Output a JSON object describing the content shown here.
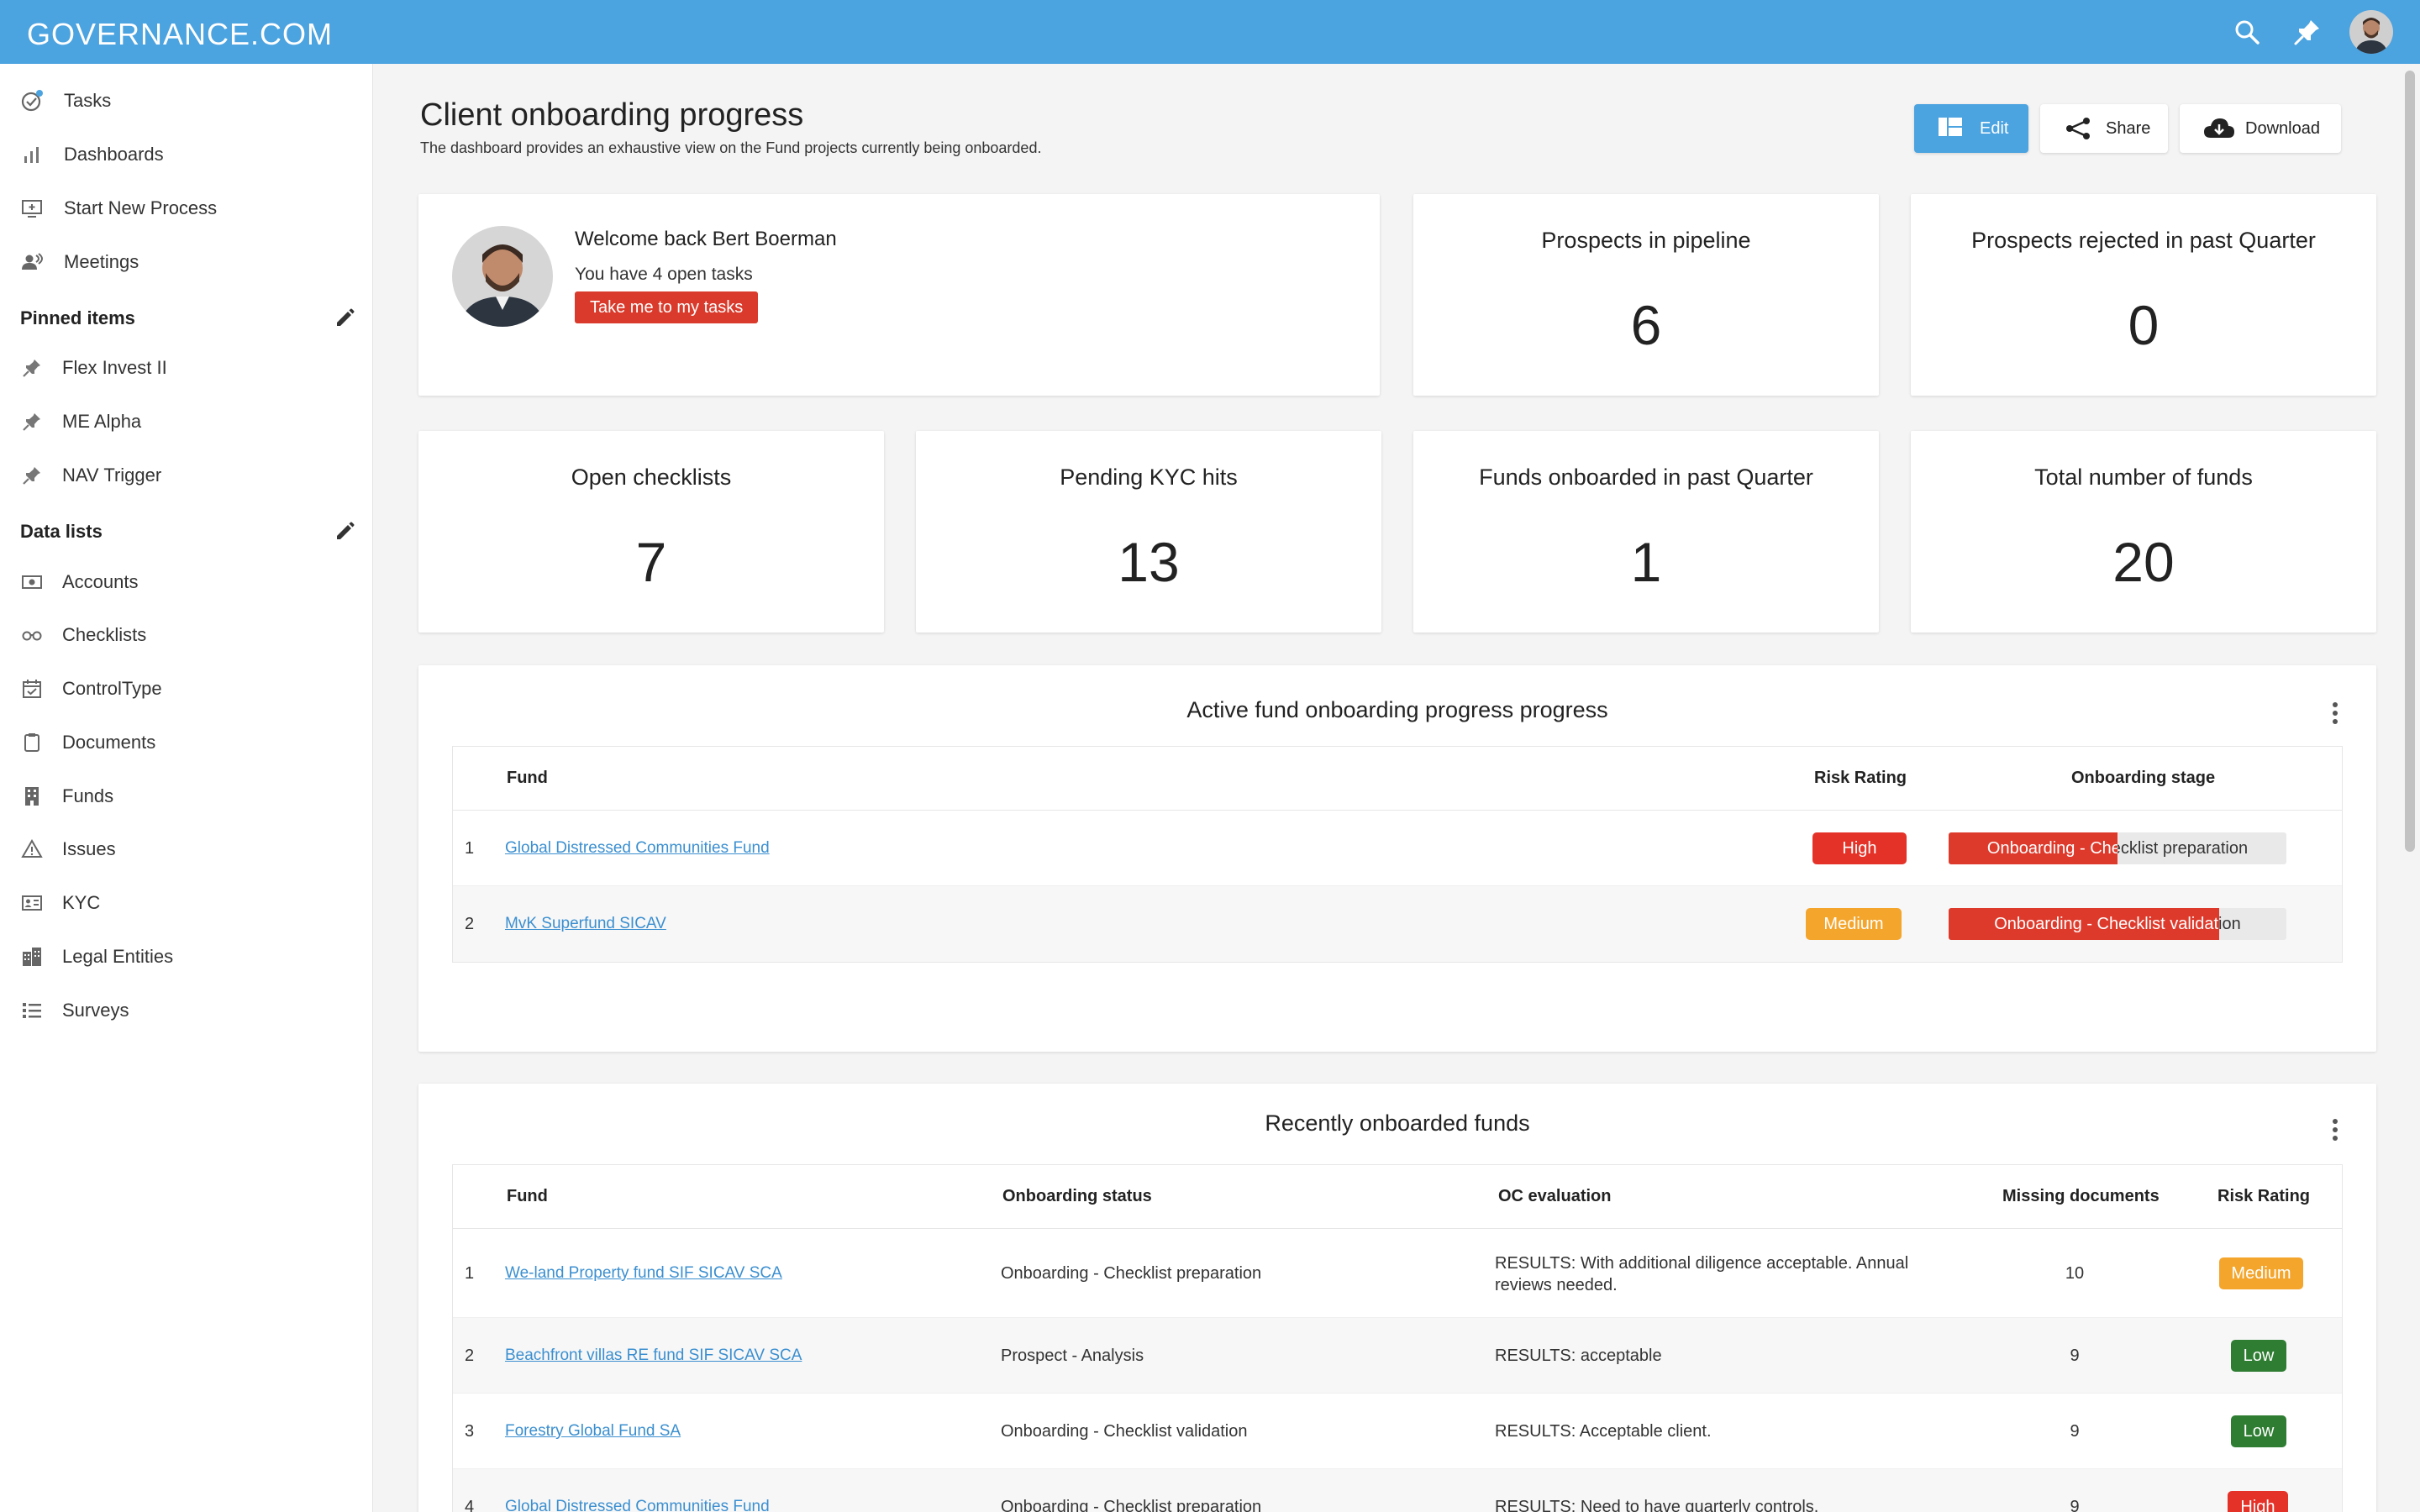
{
  "app": {
    "logo": "GOVERNANCE.COM"
  },
  "topbar": {
    "icons": [
      "search-icon",
      "pin-icon",
      "avatar"
    ]
  },
  "sidebar": {
    "main_items": [
      {
        "label": "Tasks",
        "icon": "tasks-check-icon"
      },
      {
        "label": "Dashboards",
        "icon": "bar-chart-icon"
      },
      {
        "label": "Start New Process",
        "icon": "add-screen-icon"
      },
      {
        "label": "Meetings",
        "icon": "people-icon"
      }
    ],
    "pinned_title": "Pinned items",
    "pinned": [
      {
        "label": "Flex Invest II",
        "icon": "pin-icon"
      },
      {
        "label": "ME Alpha",
        "icon": "pin-icon"
      },
      {
        "label": "NAV Trigger",
        "icon": "pin-icon"
      }
    ],
    "data_lists_title": "Data lists",
    "data_lists": [
      {
        "label": "Accounts",
        "icon": "money-icon"
      },
      {
        "label": "Checklists",
        "icon": "glasses-icon"
      },
      {
        "label": "ControlType",
        "icon": "calendar-check-icon"
      },
      {
        "label": "Documents",
        "icon": "clipboard-icon"
      },
      {
        "label": "Funds",
        "icon": "building-icon"
      },
      {
        "label": "Issues",
        "icon": "warning-icon"
      },
      {
        "label": "KYC",
        "icon": "id-card-icon"
      },
      {
        "label": "Legal Entities",
        "icon": "city-icon"
      },
      {
        "label": "Surveys",
        "icon": "list-icon"
      }
    ]
  },
  "header": {
    "title": "Client onboarding progress",
    "subtitle": "The dashboard provides an exhaustive view on the Fund projects currently being onboarded.",
    "edit_label": "Edit",
    "share_label": "Share",
    "download_label": "Download"
  },
  "welcome": {
    "title": "Welcome back Bert Boerman",
    "subtitle": "You have 4 open tasks",
    "button": "Take me to my tasks"
  },
  "kpis": [
    {
      "label": "Prospects in pipeline",
      "value": "6"
    },
    {
      "label": "Prospects rejected in past Quarter",
      "value": "0"
    },
    {
      "label": "Open checklists",
      "value": "7"
    },
    {
      "label": "Pending KYC hits",
      "value": "13"
    },
    {
      "label": "Funds onboarded in past Quarter",
      "value": "1"
    },
    {
      "label": "Total number of funds",
      "value": "20"
    }
  ],
  "active": {
    "title": "Active fund onboarding progress progress",
    "columns": [
      "Fund",
      "Risk Rating",
      "Onboarding stage"
    ],
    "rows": [
      {
        "num": "1",
        "fund": "Global Distressed Communities Fund",
        "risk": "High",
        "stage": "Onboarding - Checklist preparation",
        "progress": 0.5
      },
      {
        "num": "2",
        "fund": "MvK Superfund SICAV",
        "risk": "Medium",
        "stage": "Onboarding - Checklist validation",
        "progress": 0.8
      }
    ]
  },
  "recent": {
    "title": "Recently onboarded funds",
    "columns": [
      "Fund",
      "Onboarding status",
      "OC evaluation",
      "Missing documents",
      "Risk Rating"
    ],
    "rows": [
      {
        "num": "1",
        "fund": "We-land Property fund SIF SICAV SCA",
        "status": "Onboarding - Checklist preparation",
        "oc": "RESULTS: With additional diligence acceptable. Annual reviews needed.",
        "missing": "10",
        "risk": "Medium"
      },
      {
        "num": "2",
        "fund": "Beachfront villas RE fund SIF SICAV SCA",
        "status": "Prospect - Analysis",
        "oc": "RESULTS: acceptable",
        "missing": "9",
        "risk": "Low"
      },
      {
        "num": "3",
        "fund": "Forestry Global Fund SA",
        "status": "Onboarding - Checklist validation",
        "oc": "RESULTS: Acceptable client.",
        "missing": "9",
        "risk": "Low"
      },
      {
        "num": "4",
        "fund": "Global Distressed Communities Fund",
        "status": "Onboarding - Checklist preparation",
        "oc": "RESULTS: Need to have quarterly controls.",
        "missing": "9",
        "risk": "High"
      }
    ]
  },
  "colors": {
    "brand": "#4ba3e0",
    "high": "#e53228",
    "medium": "#f4a52c",
    "low": "#2e7d32",
    "cta": "#d93a2b"
  }
}
